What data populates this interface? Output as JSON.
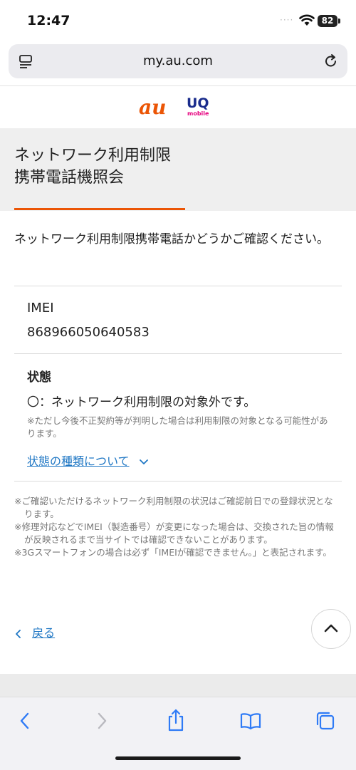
{
  "status_bar": {
    "time": "12:47",
    "signal_dots": "····",
    "battery": "82"
  },
  "browser": {
    "url": "my.au.com"
  },
  "brand": {
    "au": "au",
    "uq": "UQ",
    "uq_sub": "mobile"
  },
  "page": {
    "title_line1": "ネットワーク利用制限",
    "title_line2": "携帯電話機照会",
    "intro": "ネットワーク利用制限携帯電話かどうかご確認ください。",
    "imei_label": "IMEI",
    "imei_value": "868966050640583",
    "status_label": "状態",
    "status_value": "〇：ネットワーク利用制限の対象外です。",
    "status_note": "※ただし今後不正契約等が判明した場合は利用制限の対象となる可能性があります。",
    "status_types_link": "状態の種類について",
    "notes": [
      "※ご確認いただけるネットワーク利用制限の状況はご確認前日での登録状況となります。",
      "※修理対応などでIMEI（製造番号）が変更になった場合は、交換された旨の情報が反映されるまで当サイトでは確認できないことがあります。",
      "※3Gスマートフォンの場合は必ず「IMEIが確認できません。」と表記されます。"
    ],
    "back_link": "戻る"
  },
  "colors": {
    "accent": "#eb5505",
    "link": "#1f77c4",
    "ios_blue": "#2f7bf6"
  },
  "icons": [
    "reader-icon",
    "reload-icon",
    "chevron-down-icon",
    "chevron-left-icon",
    "chevron-up-icon",
    "back-arrow-icon",
    "forward-arrow-icon",
    "share-icon",
    "bookmarks-icon",
    "tabs-icon",
    "wifi-icon"
  ]
}
